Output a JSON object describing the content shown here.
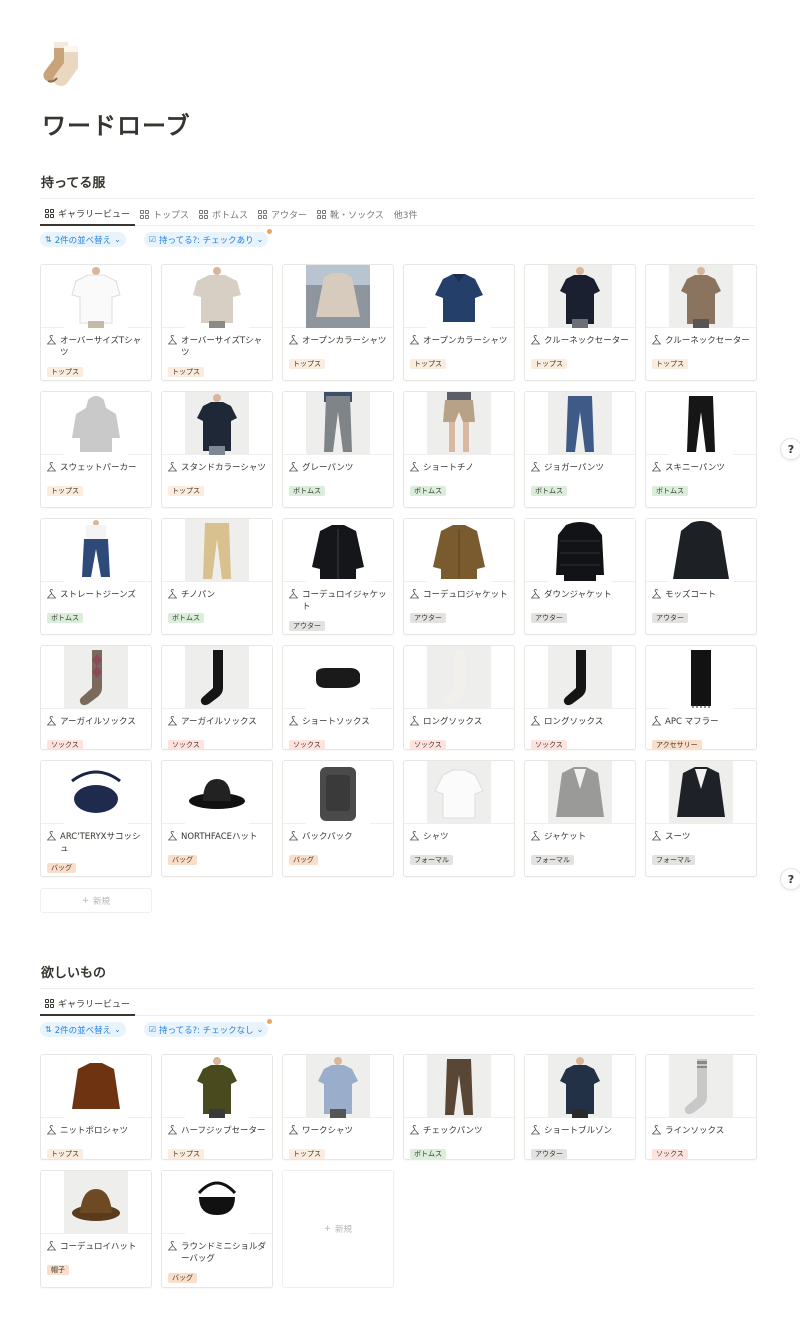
{
  "page": {
    "title": "ワードローブ",
    "icon": "socks-emoji-icon"
  },
  "colors": {
    "tops": "#fbecdd",
    "bottoms": "#dbeddb",
    "outer": "#e3e2e0",
    "socks": "#ffe2dd",
    "accessory": "#fadec9",
    "bag": "#fadec9",
    "formal": "#e3e2e0",
    "hat": "#fadec9",
    "accent": "#2383e2"
  },
  "owned": {
    "title": "持ってる服",
    "tabs": [
      {
        "label": "ギャラリービュー",
        "icon": "gallery-icon",
        "active": true
      },
      {
        "label": "トップス",
        "icon": "gallery-icon"
      },
      {
        "label": "ボトムス",
        "icon": "gallery-icon"
      },
      {
        "label": "アウター",
        "icon": "gallery-icon"
      },
      {
        "label": "靴・ソックス",
        "icon": "gallery-icon"
      },
      {
        "label": "他3件",
        "icon": ""
      }
    ],
    "sort_label": "2件の並べ替え",
    "filter_label": "持ってる?: チェックあり",
    "new_label": "新規",
    "items": [
      {
        "name": "オーバーサイズTシャツ",
        "tag": "トップス",
        "tagKey": "tops",
        "img": "tee-white"
      },
      {
        "name": "オーバーサイズTシャツ",
        "tag": "トップス",
        "tagKey": "tops",
        "img": "tee-beige"
      },
      {
        "name": "オープンカラーシャツ",
        "tag": "トップス",
        "tagKey": "tops",
        "img": "coat-beige-city"
      },
      {
        "name": "オープンカラーシャツ",
        "tag": "トップス",
        "tagKey": "tops",
        "img": "shirt-navy"
      },
      {
        "name": "クルーネックセーター",
        "tag": "トップス",
        "tagKey": "tops",
        "img": "sweater-navy"
      },
      {
        "name": "クルーネックセーター",
        "tag": "トップス",
        "tagKey": "tops",
        "img": "sweater-brown"
      },
      {
        "name": "スウェットパーカー",
        "tag": "トップス",
        "tagKey": "tops",
        "img": "hoodie-gray"
      },
      {
        "name": "スタンドカラーシャツ",
        "tag": "トップス",
        "tagKey": "tops",
        "img": "shirt-dark"
      },
      {
        "name": "グレーパンツ",
        "tag": "ボトムス",
        "tagKey": "bottoms",
        "img": "pants-gray"
      },
      {
        "name": "ショートチノ",
        "tag": "ボトムス",
        "tagKey": "bottoms",
        "img": "shorts-beige"
      },
      {
        "name": "ジョガーパンツ",
        "tag": "ボトムス",
        "tagKey": "bottoms",
        "img": "jeans-blue"
      },
      {
        "name": "スキニーパンツ",
        "tag": "ボトムス",
        "tagKey": "bottoms",
        "img": "pants-black"
      },
      {
        "name": "ストレートジーンズ",
        "tag": "ボトムス",
        "tagKey": "bottoms",
        "img": "jeans-straight"
      },
      {
        "name": "チノパン",
        "tag": "ボトムス",
        "tagKey": "bottoms",
        "img": "chino-beige"
      },
      {
        "name": "コーデュロイジャケット",
        "tag": "アウター",
        "tagKey": "outer",
        "img": "jacket-black"
      },
      {
        "name": "コーデュロジャケット",
        "tag": "アウター",
        "tagKey": "outer",
        "img": "jacket-brown"
      },
      {
        "name": "ダウンジャケット",
        "tag": "アウター",
        "tagKey": "outer",
        "img": "down-black"
      },
      {
        "name": "モッズコート",
        "tag": "アウター",
        "tagKey": "outer",
        "img": "coat-black"
      },
      {
        "name": "アーガイルソックス",
        "tag": "ソックス",
        "tagKey": "socks",
        "img": "sock-argyle"
      },
      {
        "name": "アーガイルソックス",
        "tag": "ソックス",
        "tagKey": "socks",
        "img": "sock-black-short"
      },
      {
        "name": "ショートソックス",
        "tag": "ソックス",
        "tagKey": "socks",
        "img": "sock-ankle"
      },
      {
        "name": "ロングソックス",
        "tag": "ソックス",
        "tagKey": "socks",
        "img": "sock-white-long"
      },
      {
        "name": "ロングソックス",
        "tag": "ソックス",
        "tagKey": "socks",
        "img": "sock-black-long"
      },
      {
        "name": "APC マフラー",
        "tag": "アクセサリー",
        "tagKey": "accessory",
        "img": "muffler"
      },
      {
        "name": "ARC'TERYXサコッシュ",
        "tag": "バッグ",
        "tagKey": "bag",
        "img": "sacoche"
      },
      {
        "name": "NORTHFACEハット",
        "tag": "バッグ",
        "tagKey": "bag",
        "img": "hat-black"
      },
      {
        "name": "バックパック",
        "tag": "バッグ",
        "tagKey": "bag",
        "img": "backpack"
      },
      {
        "name": "シャツ",
        "tag": "フォーマル",
        "tagKey": "formal",
        "img": "shirt-white"
      },
      {
        "name": "ジャケット",
        "tag": "フォーマル",
        "tagKey": "formal",
        "img": "blazer-gray"
      },
      {
        "name": "スーツ",
        "tag": "フォーマル",
        "tagKey": "formal",
        "img": "suit-black"
      }
    ]
  },
  "wish": {
    "title": "欲しいもの",
    "tabs": [
      {
        "label": "ギャラリービュー",
        "icon": "gallery-icon",
        "active": true
      }
    ],
    "sort_label": "2件の並べ替え",
    "filter_label": "持ってる?: チェックなし",
    "new_label": "新規",
    "items": [
      {
        "name": "ニットポロシャツ",
        "tag": "トップス",
        "tagKey": "tops",
        "img": "polo-brown"
      },
      {
        "name": "ハーフジップセーター",
        "tag": "トップス",
        "tagKey": "tops",
        "img": "halfzip-olive"
      },
      {
        "name": "ワークシャツ",
        "tag": "トップス",
        "tagKey": "tops",
        "img": "workshirt-blue"
      },
      {
        "name": "チェックパンツ",
        "tag": "ボトムス",
        "tagKey": "bottoms",
        "img": "pants-brown"
      },
      {
        "name": "ショートブルゾン",
        "tag": "アウター",
        "tagKey": "outer",
        "img": "blouson-navy"
      },
      {
        "name": "ラインソックス",
        "tag": "ソックス",
        "tagKey": "socks",
        "img": "sock-line"
      },
      {
        "name": "コーデュロイハット",
        "tag": "帽子",
        "tagKey": "hat",
        "img": "bucket-brown"
      },
      {
        "name": "ラウンドミニショルダーバッグ",
        "tag": "バッグ",
        "tagKey": "bag",
        "img": "shoulder-bag"
      }
    ]
  },
  "help": {
    "label": "?"
  }
}
